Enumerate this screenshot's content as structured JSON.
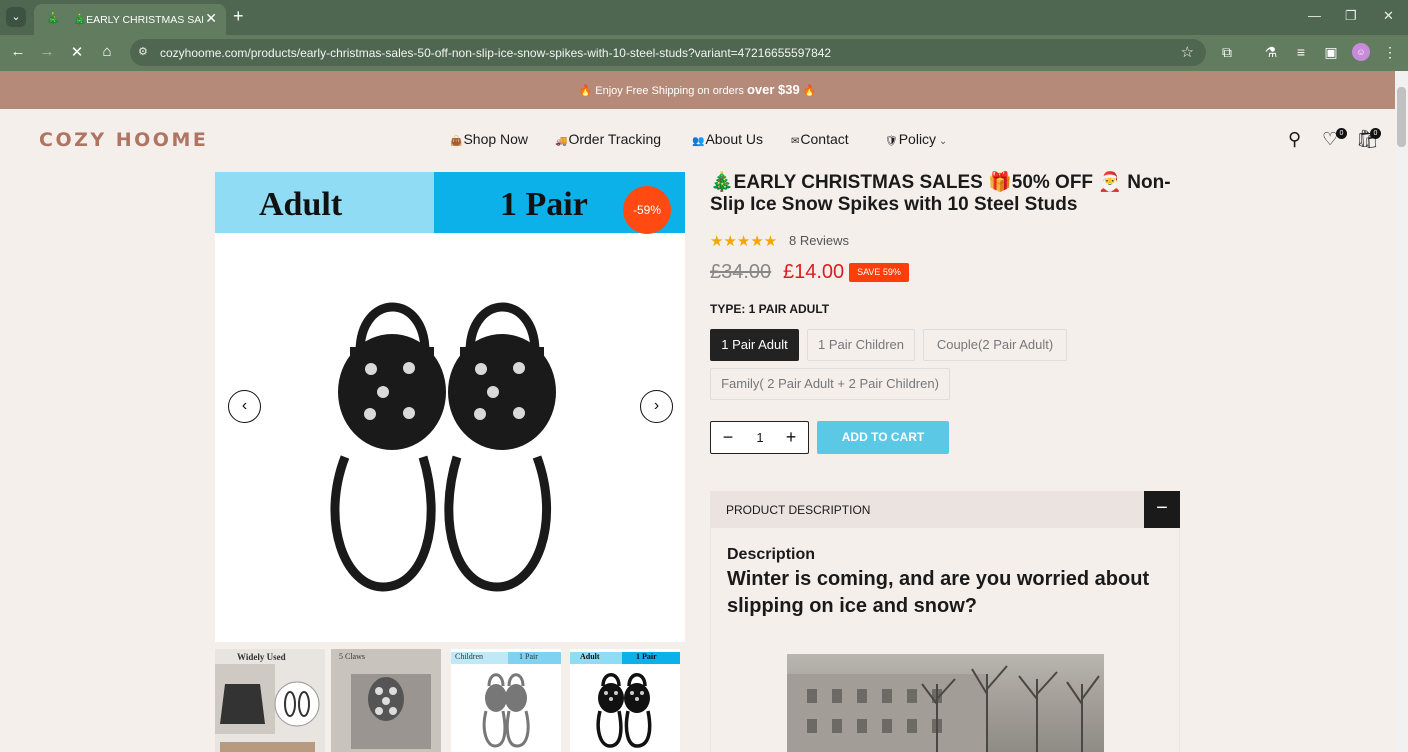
{
  "browser": {
    "tab_title": "🎄EARLY CHRISTMAS SALES 🎁",
    "url": "cozyhoome.com/products/early-christmas-sales-50-off-non-slip-ice-snow-spikes-with-10-steel-studs?variant=47216655597842"
  },
  "announcement": {
    "text": "Enjoy Free Shipping on orders",
    "emphasis": "over $39"
  },
  "header": {
    "logo": "COZY HOOME",
    "nav": [
      {
        "label": "Shop Now"
      },
      {
        "label": "Order Tracking"
      },
      {
        "label": "About Us"
      },
      {
        "label": "Contact"
      },
      {
        "label": "Policy"
      }
    ],
    "wishlist_count": "0",
    "cart_count": "0"
  },
  "gallery": {
    "banner_left": "Adult",
    "banner_right": "1 Pair",
    "discount": "-59%",
    "thumbnails": [
      {
        "label": "Widely Used"
      },
      {
        "label": "5 Claws"
      },
      {
        "label_a": "Children",
        "label_b": "1 Pair"
      },
      {
        "label_a": "Adult",
        "label_b": "1 Pair"
      }
    ]
  },
  "product": {
    "title": "🎄EARLY CHRISTMAS SALES 🎁50% OFF 🎅 Non-Slip Ice Snow Spikes with 10 Steel Studs",
    "stars": "★★★★★",
    "reviews": "8 Reviews",
    "price_old": "£34.00",
    "price_new": "£14.00",
    "save_badge": "SAVE 59%",
    "type_label": "TYPE: 1 PAIR ADULT",
    "variants": [
      {
        "label": "1 Pair Adult",
        "selected": true
      },
      {
        "label": "1 Pair Children",
        "selected": false
      },
      {
        "label": "Couple(2 Pair Adult)",
        "selected": false
      },
      {
        "label": "Family( 2 Pair Adult + 2 Pair Children)",
        "selected": false
      }
    ],
    "quantity": "1",
    "add_to_cart": "ADD TO CART"
  },
  "description": {
    "accordion_label": "PRODUCT DESCRIPTION",
    "heading": "Description",
    "lead": "Winter is coming, and are you worried about slipping on ice and snow?"
  },
  "colors": {
    "browser_frame": "#4f6750",
    "announcement_bar": "#b68a78",
    "price_sale": "#dd1d1d",
    "badge": "#ff3d0a",
    "add_to_cart": "#5bc8e6",
    "page_bg": "#f5efec"
  }
}
